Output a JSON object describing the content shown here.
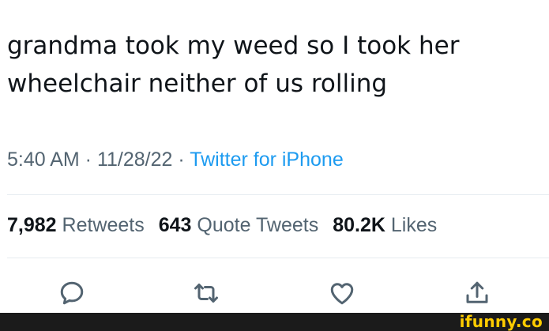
{
  "tweet": {
    "text_line1": "grandma took my weed so I took her",
    "text_line2": "wheelchair neither of us rolling",
    "time": "5:40 AM",
    "date": "11/28/22",
    "separator": " · ",
    "source": "Twitter for iPhone"
  },
  "stats": {
    "retweets_count": "7,982",
    "retweets_label": "Retweets",
    "quotes_count": "643",
    "quotes_label": "Quote Tweets",
    "likes_count": "80.2K",
    "likes_label": "Likes"
  },
  "actions": {
    "reply_icon": "reply-icon",
    "retweet_icon": "retweet-icon",
    "like_icon": "heart-icon",
    "share_icon": "share-icon"
  },
  "watermark": {
    "text": "ifunny.co"
  },
  "colors": {
    "text": "#0f1419",
    "secondary": "#536471",
    "accent": "#1d9bf0",
    "watermark": "#ffcc00"
  }
}
